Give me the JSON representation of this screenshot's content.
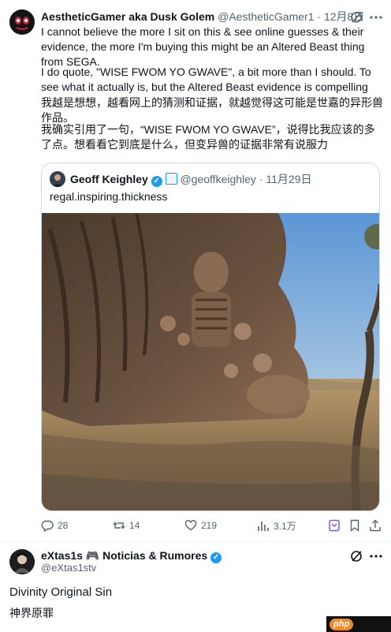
{
  "tweet": {
    "author_name": "AestheticGamer aka Dusk Golem",
    "handle": "@AestheticGamer1",
    "separator": "·",
    "date": "12月8日",
    "paragraph_en_1": "I cannot believe the more I sit on this & see online guesses & their evidence, the more I'm buying this might be an Altered Beast thing from SEGA.",
    "paragraph_en_2": "I do quote, \"WISE FWOM YO GWAVE\", a bit more than I should. To see what it actually is, but the Altered Beast evidence is compelling",
    "paragraph_zh_1": "我越是想想，越看网上的猜测和证据，就越觉得这可能是世嘉的异形兽作品。",
    "paragraph_zh_2": "我确实引用了一句，“WISE FWOM YO GWAVE”，说得比我应该的多了点。想看看它到底是什么，但变异兽的证据非常有说服力"
  },
  "quote": {
    "author_name": "Geoff Keighley",
    "handle": "@geoffkeighley",
    "separator": "·",
    "date": "11月29日",
    "text": "regal.inspiring.thickness"
  },
  "actions": {
    "replies": "28",
    "retweets": "14",
    "likes": "219",
    "views": "3.1万"
  },
  "reply": {
    "author_name": "eXtas1s 🎮 Noticias & Rumores",
    "handle": "@eXtas1stv",
    "text_en": "Divinity Original Sin",
    "text_zh": "神界原罪"
  },
  "watermark": "php",
  "colors": {
    "accent": "#1d9bf0",
    "text": "#0f1419",
    "muted": "#536471",
    "bookmark_purple": "#7856ff",
    "watermark_orange": "#f08a24"
  }
}
